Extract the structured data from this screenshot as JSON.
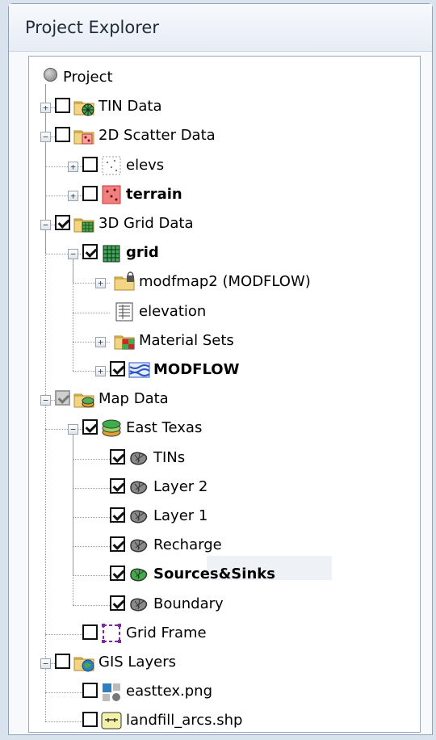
{
  "panel": {
    "title": "Project Explorer"
  },
  "tree": [
    {
      "label": "Project",
      "level": 0,
      "icon": "project-radio-icon",
      "expander": null,
      "checkbox": null,
      "bold": false
    },
    {
      "label": "TIN Data",
      "level": 0,
      "icon": "tin-folder-icon",
      "expander": "collapsed",
      "checkbox": "unchecked",
      "bold": false
    },
    {
      "label": "2D Scatter Data",
      "level": 0,
      "icon": "scatter-folder-icon",
      "expander": "expanded",
      "checkbox": "unchecked",
      "bold": false
    },
    {
      "label": "elevs",
      "level": 1,
      "icon": "scatter-set-icon",
      "expander": "collapsed",
      "checkbox": "unchecked",
      "bold": false
    },
    {
      "label": "terrain",
      "level": 1,
      "icon": "scatter-set-active-icon",
      "expander": "collapsed",
      "checkbox": "unchecked",
      "bold": true
    },
    {
      "label": "3D Grid Data",
      "level": 0,
      "icon": "grid-folder-icon",
      "expander": "expanded",
      "checkbox": "checked",
      "bold": false
    },
    {
      "label": "grid",
      "level": 1,
      "icon": "grid-icon",
      "expander": "expanded",
      "checkbox": "checked",
      "bold": true
    },
    {
      "label": "modfmap2 (MODFLOW)",
      "level": 2,
      "icon": "locked-folder-icon",
      "expander": "collapsed",
      "checkbox": null,
      "bold": false
    },
    {
      "label": "elevation",
      "level": 2,
      "icon": "dataset-icon",
      "expander": null,
      "checkbox": null,
      "bold": false
    },
    {
      "label": "Material Sets",
      "level": 2,
      "icon": "material-folder-icon",
      "expander": "collapsed",
      "checkbox": null,
      "bold": false
    },
    {
      "label": "MODFLOW",
      "level": 2,
      "icon": "modflow-icon",
      "expander": "collapsed",
      "checkbox": "checked",
      "bold": true
    },
    {
      "label": "Map Data",
      "level": 0,
      "icon": "map-folder-icon",
      "expander": "expanded",
      "checkbox": "indeterminate",
      "bold": false
    },
    {
      "label": "East Texas",
      "level": 1,
      "icon": "coverage-group-icon",
      "expander": "expanded",
      "checkbox": "checked",
      "bold": false
    },
    {
      "label": "TINs",
      "level": 2,
      "icon": "coverage-icon",
      "expander": null,
      "checkbox": "checked",
      "bold": false
    },
    {
      "label": "Layer 2",
      "level": 2,
      "icon": "coverage-icon",
      "expander": null,
      "checkbox": "checked",
      "bold": false
    },
    {
      "label": "Layer 1",
      "level": 2,
      "icon": "coverage-icon",
      "expander": null,
      "checkbox": "checked",
      "bold": false
    },
    {
      "label": "Recharge",
      "level": 2,
      "icon": "coverage-icon",
      "expander": null,
      "checkbox": "checked",
      "bold": false
    },
    {
      "label": "Sources&Sinks",
      "level": 2,
      "icon": "coverage-active-icon",
      "expander": null,
      "checkbox": "checked",
      "bold": true
    },
    {
      "label": "Boundary",
      "level": 2,
      "icon": "coverage-icon",
      "expander": null,
      "checkbox": "checked",
      "bold": false
    },
    {
      "label": "Grid Frame",
      "level": 1,
      "icon": "grid-frame-icon",
      "expander": null,
      "checkbox": "unchecked",
      "bold": false
    },
    {
      "label": "GIS Layers",
      "level": 0,
      "icon": "gis-folder-icon",
      "expander": "expanded",
      "checkbox": "unchecked",
      "bold": false
    },
    {
      "label": "easttex.png",
      "level": 1,
      "icon": "image-icon",
      "expander": null,
      "checkbox": "unchecked",
      "bold": false
    },
    {
      "label": "landfill_arcs.shp",
      "level": 1,
      "icon": "shapefile-icon",
      "expander": null,
      "checkbox": "unchecked",
      "bold": false
    }
  ],
  "colors": {
    "folder": "#e8c56a",
    "coverage": "#8a8a8a",
    "coverage_active": "#3fae49",
    "modflow": "#2a55c4",
    "scatter_active": "#f08080"
  }
}
